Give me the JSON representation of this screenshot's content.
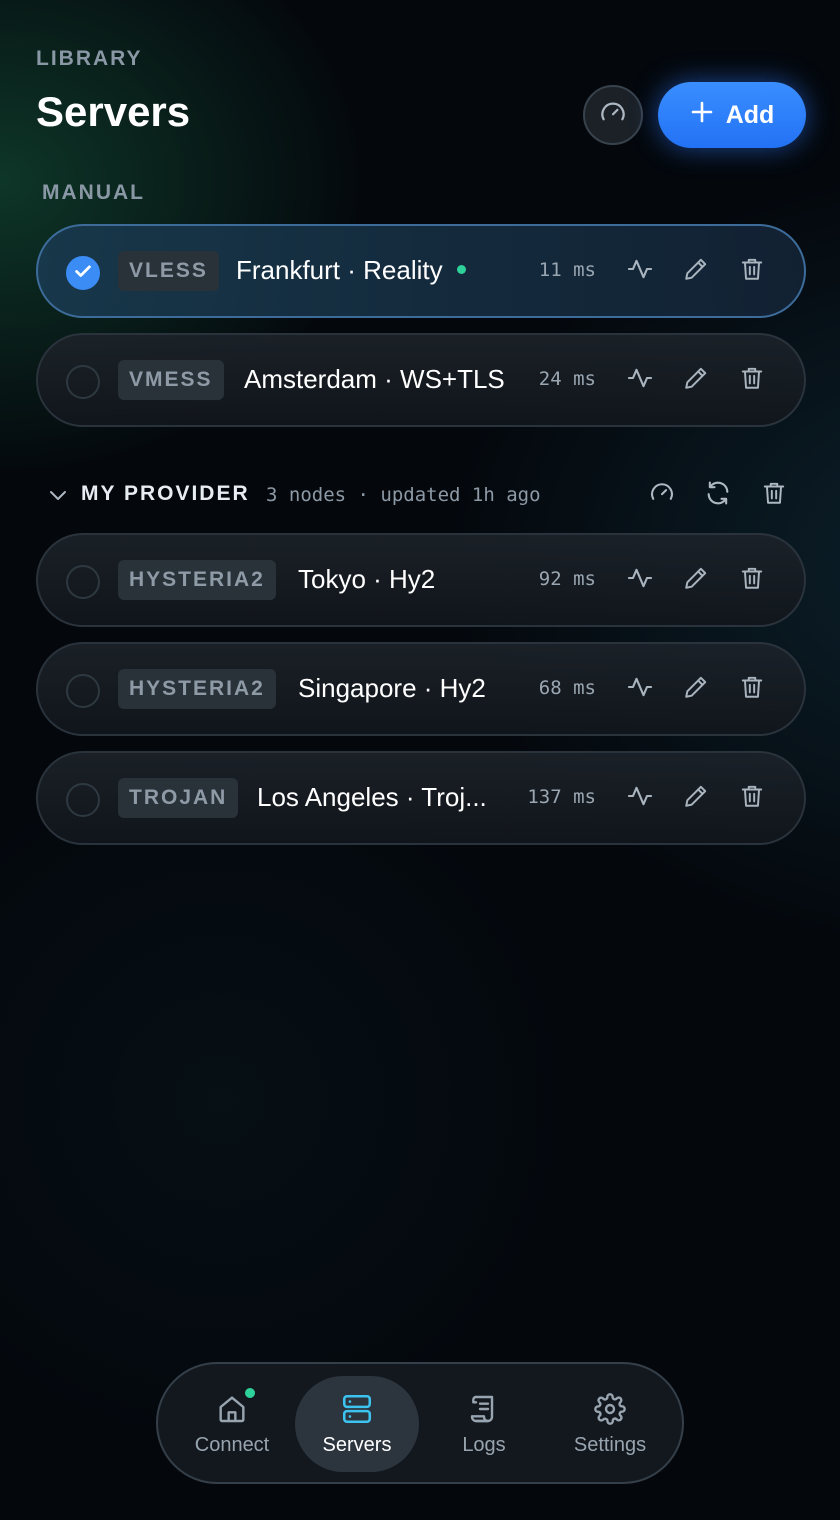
{
  "header": {
    "eyebrow": "LIBRARY",
    "title": "Servers",
    "gauge_icon": "speedometer-icon",
    "add_label": "Add",
    "add_icon": "plus-icon",
    "accent_color": "#2f7ff8"
  },
  "manual": {
    "label": "MANUAL",
    "servers": [
      {
        "protocol": "VLESS",
        "name": "Frankfurt · Reality",
        "latency": "11 ms",
        "selected": true,
        "online": true
      },
      {
        "protocol": "VMESS",
        "name": "Amsterdam · WS+TLS",
        "latency": "24 ms",
        "selected": false,
        "online": false
      }
    ]
  },
  "provider": {
    "name": "MY PROVIDER",
    "meta": "3 nodes · updated 1h ago",
    "servers": [
      {
        "protocol": "HYSTERIA2",
        "name": "Tokyo · Hy2",
        "latency": "92 ms",
        "selected": false
      },
      {
        "protocol": "HYSTERIA2",
        "name": "Singapore · Hy2",
        "latency": "68 ms",
        "selected": false
      },
      {
        "protocol": "TROJAN",
        "name": "Los Angeles · Troj...",
        "latency": "137 ms",
        "selected": false
      }
    ]
  },
  "tabs": [
    {
      "label": "Connect",
      "icon": "home-icon",
      "active": false,
      "indicator": true
    },
    {
      "label": "Servers",
      "icon": "server-icon",
      "active": true,
      "indicator": false
    },
    {
      "label": "Logs",
      "icon": "scroll-icon",
      "active": false,
      "indicator": false
    },
    {
      "label": "Settings",
      "icon": "gear-icon",
      "active": false,
      "indicator": false
    }
  ],
  "colors": {
    "online": "#2fd19a",
    "selected_border": "#3d6c9b",
    "active_tab_icon": "#3cc3f0"
  }
}
